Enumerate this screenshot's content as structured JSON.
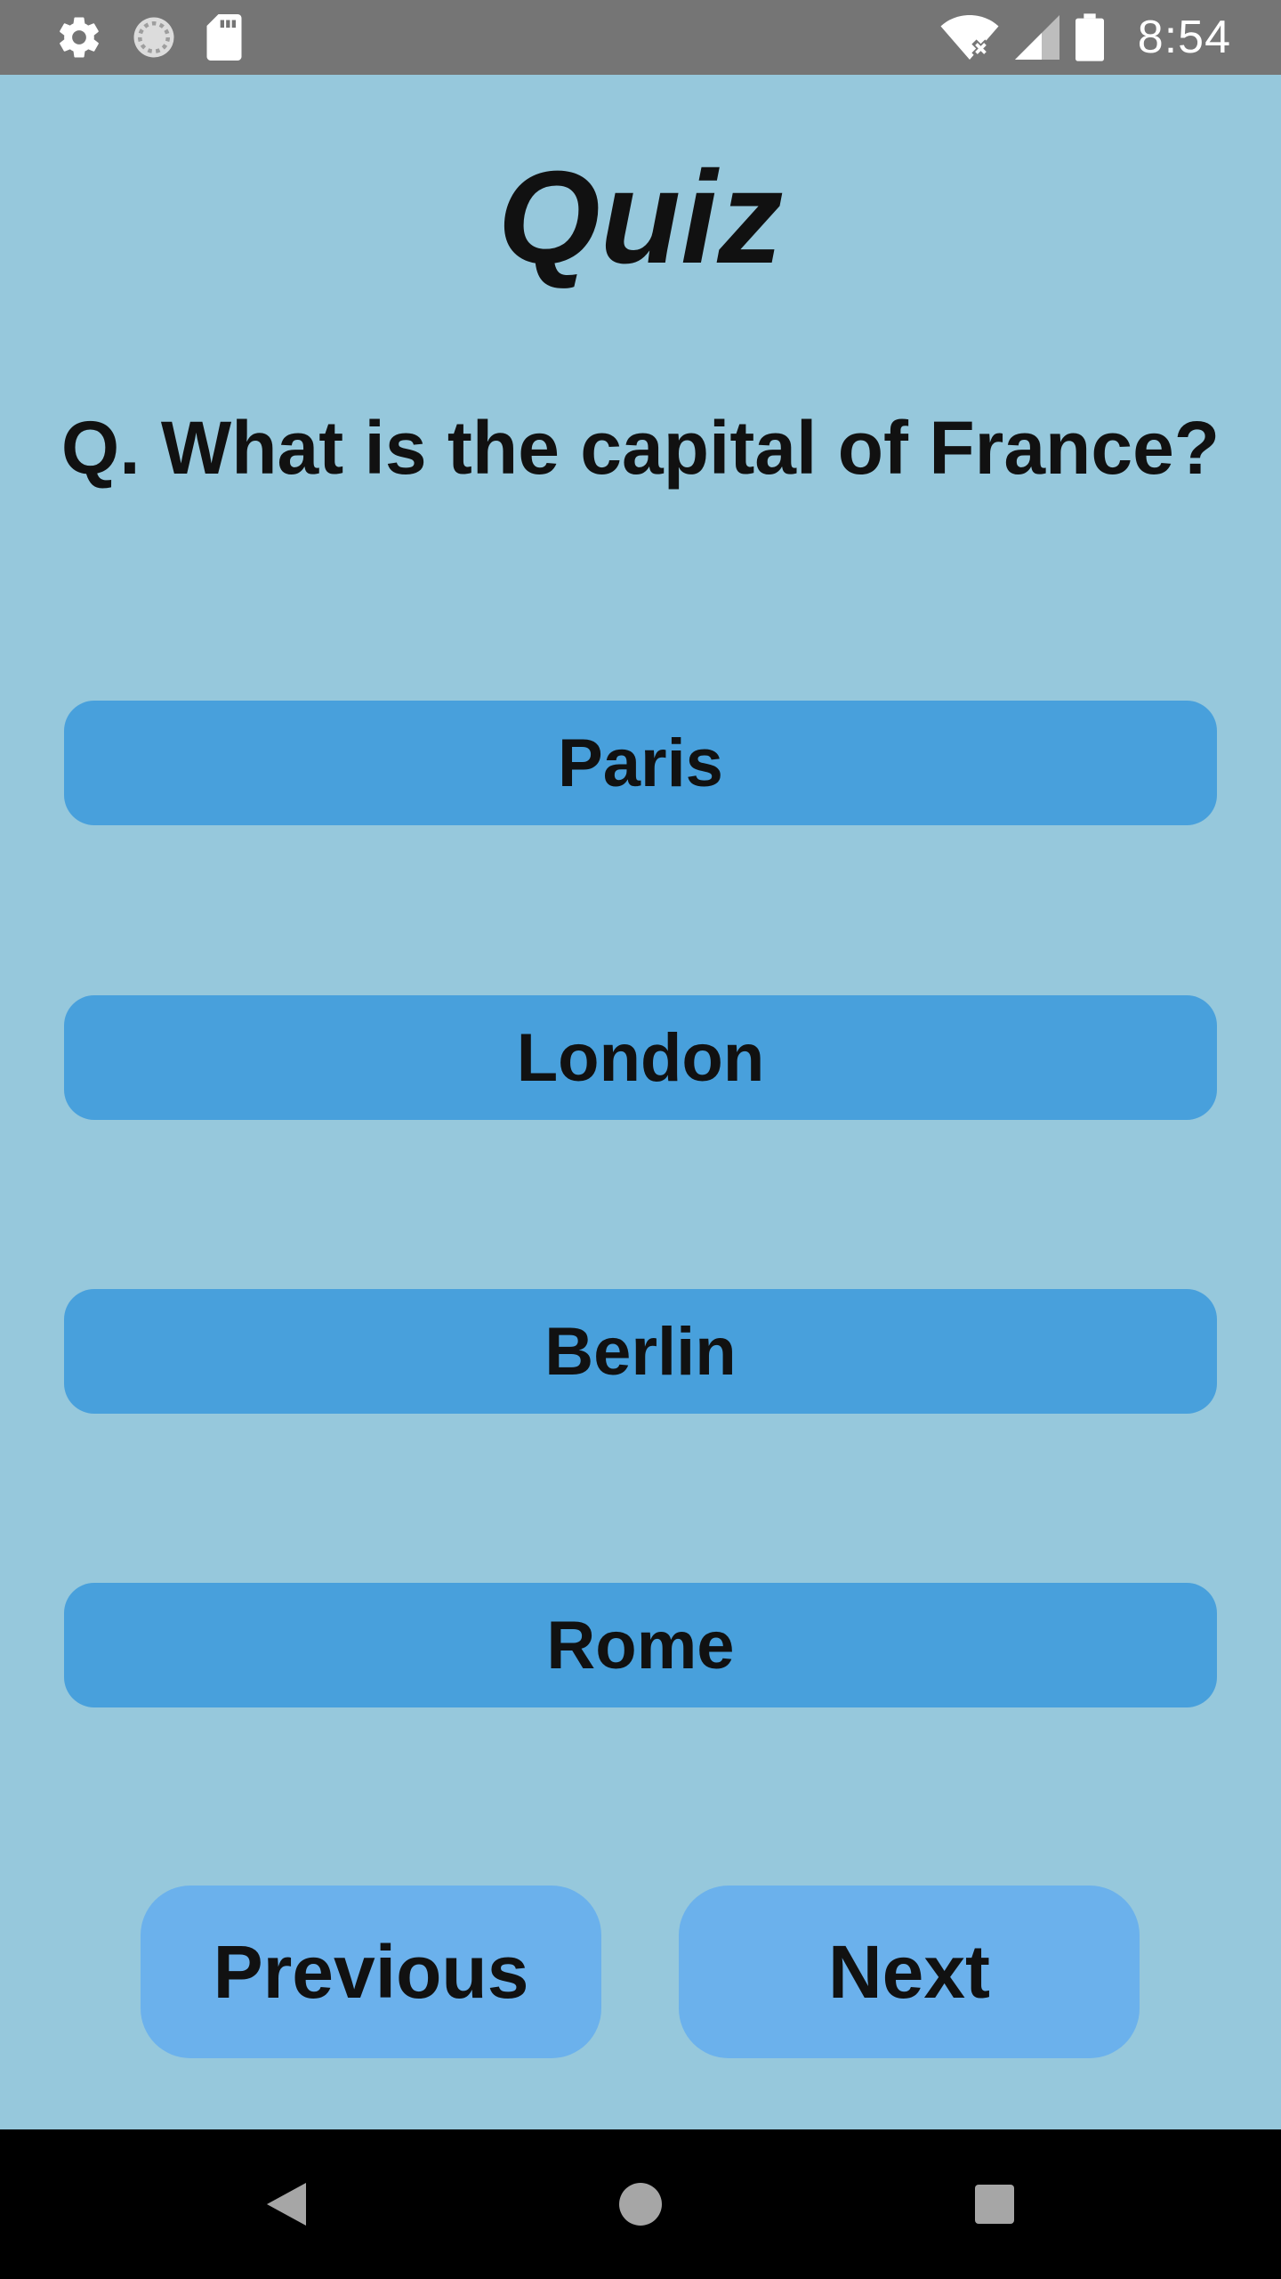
{
  "status_bar": {
    "time": "8:54",
    "icons": [
      "settings-icon",
      "sync-icon",
      "sd-card-icon",
      "wifi-off-icon",
      "signal-icon",
      "battery-icon"
    ]
  },
  "quiz": {
    "title": "Quiz",
    "question": "Q. What is the capital of France?",
    "options": [
      "Paris",
      "London",
      "Berlin",
      "Rome"
    ],
    "previous_label": "Previous",
    "next_label": "Next"
  },
  "navigation_bar": {
    "icons": [
      "back-icon",
      "home-icon",
      "recents-icon"
    ]
  },
  "colors": {
    "background": "#96c8dc",
    "option_button": "#48a0dc",
    "nav_button": "#6bb1ec",
    "status_bar": "#757575"
  }
}
